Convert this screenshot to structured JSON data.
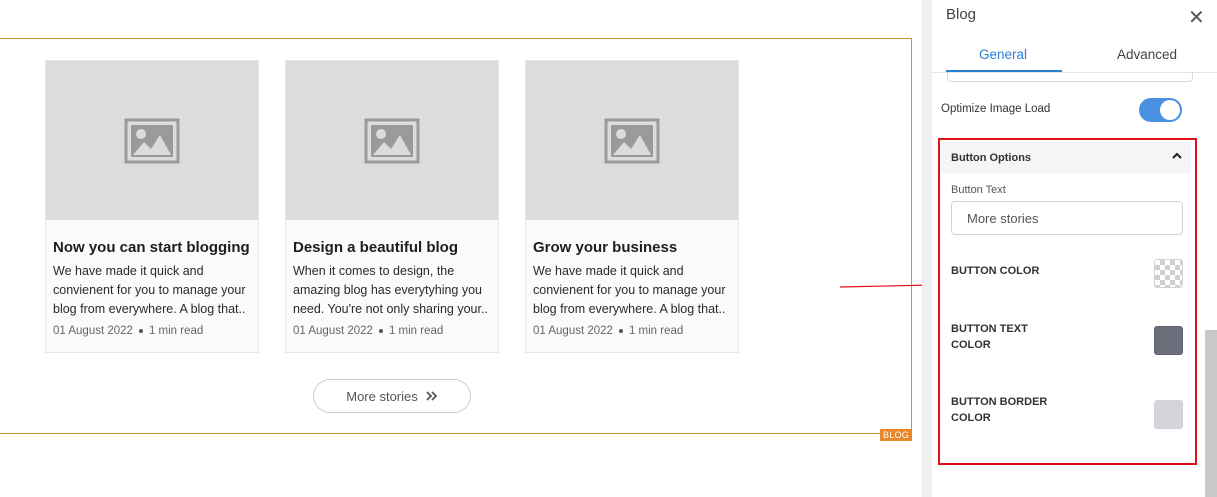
{
  "canvas": {
    "cards": [
      {
        "title": "Now you can start blogging",
        "excerpt": "We have made it quick and convienent for you to manage your blog from everywhere. A blog that..",
        "date": "01 August 2022",
        "read_time": "1 min read"
      },
      {
        "title": "Design a beautiful blog",
        "excerpt": "When it comes to design, the amazing blog has everytyhing you need. You're not only sharing your..",
        "date": "01 August 2022",
        "read_time": "1 min read"
      },
      {
        "title": "Grow your business",
        "excerpt": "We have made it quick and convienent for you to manage your blog from everywhere. A blog that..",
        "date": "01 August 2022",
        "read_time": "1 min read"
      }
    ],
    "more_button_label": "More stories",
    "element_tag": "BLOG",
    "frame_color": "#d9903a",
    "arrow_color": "#e0101a"
  },
  "panel": {
    "title": "Blog",
    "tabs": [
      {
        "label": "General",
        "active": true
      },
      {
        "label": "Advanced",
        "active": false
      }
    ],
    "optimize_image_load": {
      "label": "Optimize Image Load",
      "enabled": true
    },
    "button_options": {
      "section_title": "Button Options",
      "expanded": true,
      "button_text_label": "Button Text",
      "button_text_value": "More stories",
      "colors": [
        {
          "label": "BUTTON COLOR",
          "value": "transparent"
        },
        {
          "label": "BUTTON TEXT COLOR",
          "value": "#6b6f7b"
        },
        {
          "label": "BUTTON BORDER COLOR",
          "value": "#d3d5da"
        }
      ]
    },
    "accent_color": "#2b7fd3",
    "highlight_color": "#e0101a"
  }
}
